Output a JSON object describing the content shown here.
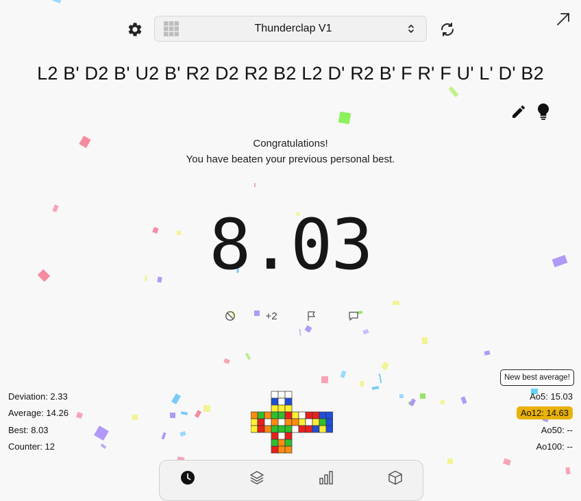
{
  "header": {
    "puzzle_name": "Thunderclap V1",
    "settings_icon": "gear-icon",
    "refresh_icon": "refresh-icon",
    "fullscreen_icon": "arrow-up-right-icon"
  },
  "scramble": "L2 B' D2 B' U2 B' R2 D2 R2 B2 L2 D' R2 B' F R' F U' L' D' B2",
  "message": {
    "line1": "Congratulations!",
    "line2": "You have beaten your previous personal best."
  },
  "timer": {
    "value": "8.03"
  },
  "actions": {
    "plus2_label": "+2"
  },
  "stats_left": {
    "deviation": "Deviation: 2.33",
    "average": "Average: 14.26",
    "best": "Best: 8.03",
    "counter": "Counter: 12"
  },
  "stats_right": {
    "new_best": "New best average!",
    "ao5": "Ao5: 15.03",
    "ao12": "Ao12: 14.63",
    "ao50": "Ao50: --",
    "ao100": "Ao100: --"
  },
  "colors": {
    "ao12_highlight": "#e8b10c",
    "cube": {
      "W": "#ffffff",
      "Y": "#ffee33",
      "R": "#e8201c",
      "O": "#ff8c0f",
      "G": "#2fbf2f",
      "B": "#1f4fd8"
    }
  },
  "cube_net": {
    "U": [
      "WWW",
      "BWB",
      "YYY"
    ],
    "L": [
      "OGO",
      "YRW",
      "YRO"
    ],
    "F": [
      "GGR",
      "OWO",
      "GGG"
    ],
    "R": [
      "YWR",
      "OYW",
      "WRR"
    ],
    "B": [
      "RBB",
      "YGB",
      "BYB"
    ],
    "D": [
      "RWR",
      "GOG",
      "ROO"
    ]
  },
  "nav": [
    {
      "name": "nav-timer",
      "icon": "clock-icon"
    },
    {
      "name": "nav-sessions",
      "icon": "layers-icon"
    },
    {
      "name": "nav-stats",
      "icon": "bar-chart-icon"
    },
    {
      "name": "nav-cube",
      "icon": "cube-icon"
    }
  ]
}
